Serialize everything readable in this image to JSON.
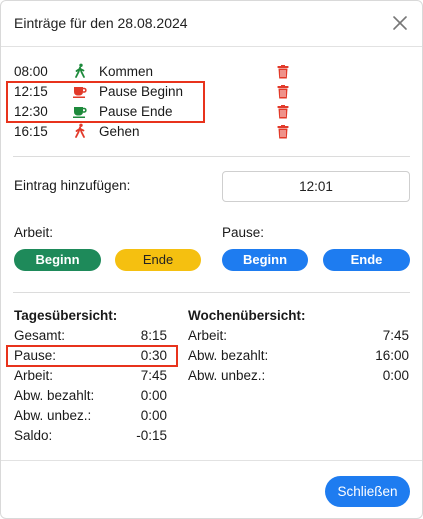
{
  "dialog": {
    "title": "Einträge für den 28.08.2024",
    "close_icon": "close-icon"
  },
  "entries": [
    {
      "time": "08:00",
      "label": "Kommen",
      "icon": "walking-person-icon",
      "icon_color": "#1e8a3c"
    },
    {
      "time": "12:15",
      "label": "Pause Beginn",
      "icon": "coffee-cup-icon",
      "icon_color": "#e23a2a"
    },
    {
      "time": "12:30",
      "label": "Pause Ende",
      "icon": "coffee-cup-icon",
      "icon_color": "#1e8a3c"
    },
    {
      "time": "16:15",
      "label": "Gehen",
      "icon": "walking-person-icon",
      "icon_color": "#e23a2a"
    }
  ],
  "add_entry": {
    "label": "Eintrag hinzufügen:",
    "time_value": "12:01"
  },
  "arbeit": {
    "label": "Arbeit:",
    "start_label": "Beginn",
    "end_label": "Ende"
  },
  "pause": {
    "label": "Pause:",
    "start_label": "Beginn",
    "end_label": "Ende"
  },
  "tagesuebersicht": {
    "title": "Tagesübersicht:",
    "rows": [
      {
        "key": "Gesamt:",
        "value": "8:15"
      },
      {
        "key": "Pause:",
        "value": "0:30"
      },
      {
        "key": "Arbeit:",
        "value": "7:45"
      },
      {
        "key": "Abw. bezahlt:",
        "value": "0:00"
      },
      {
        "key": "Abw. unbez.:",
        "value": "0:00"
      },
      {
        "key": "Saldo:",
        "value": "-0:15"
      }
    ]
  },
  "wochenuebersicht": {
    "title": "Wochenübersicht:",
    "rows": [
      {
        "key": "Arbeit:",
        "value": "7:45"
      },
      {
        "key": "Abw. bezahlt:",
        "value": "16:00"
      },
      {
        "key": "Abw. unbez.:",
        "value": "0:00"
      }
    ]
  },
  "footer": {
    "close_label": "Schließen"
  },
  "colors": {
    "accent_blue": "#1e7cf0",
    "green": "#1e8a5a",
    "yellow": "#f5c010",
    "delete_red": "#e23a2a",
    "highlight": "#e8331c"
  }
}
